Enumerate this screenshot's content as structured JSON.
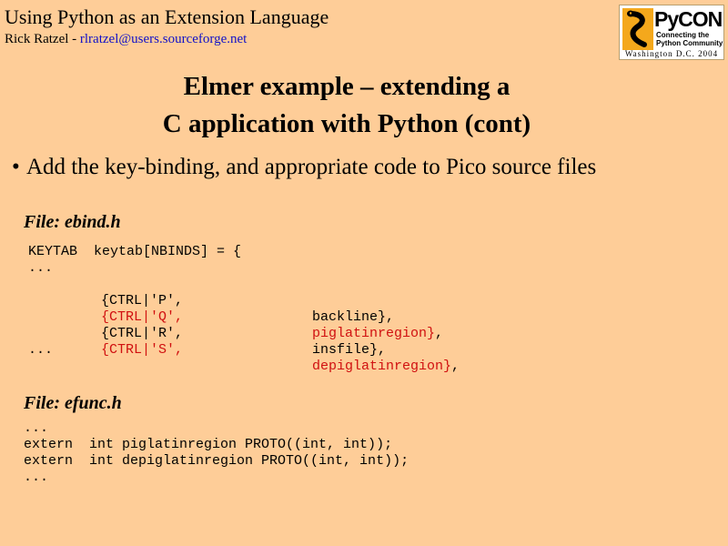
{
  "header": {
    "title": "Using Python as an Extension Language",
    "author": "Rick Ratzel - ",
    "email": "rlratzel@users.sourceforge.net"
  },
  "logo": {
    "name": "PyCON",
    "tagline": "Connecting the Python Community",
    "location": "Washington D.C. 2004"
  },
  "slide": {
    "title_line1": "Elmer example – extending a",
    "title_line2": "C application with Python (cont)",
    "bullet": "Add the key-binding, and appropriate code to Pico source files"
  },
  "ebind": {
    "label": "File: ebind.h",
    "line1": "KEYTAB  keytab[NBINDS] = {",
    "ellipsis1": "...",
    "entries": [
      {
        "key": "{CTRL|'P',",
        "func": "backline},",
        "highlight": false
      },
      {
        "key": "{CTRL|'Q',",
        "func": "piglatinregion}",
        "highlight": true
      },
      {
        "key": "{CTRL|'R',",
        "func": "insfile},",
        "highlight": false
      },
      {
        "key": "{CTRL|'S',",
        "func": "depiglatinregion}",
        "highlight": true
      }
    ],
    "ellipsis2": "..."
  },
  "efunc": {
    "label": "File: efunc.h",
    "ellipsis1": "...",
    "line1": "extern  int piglatinregion PROTO((int, int));",
    "line2": "extern  int depiglatinregion PROTO((int, int));",
    "ellipsis2": "..."
  },
  "colors": {
    "background": "#fecd98",
    "highlight": "#d01010",
    "link": "#1010c8"
  }
}
